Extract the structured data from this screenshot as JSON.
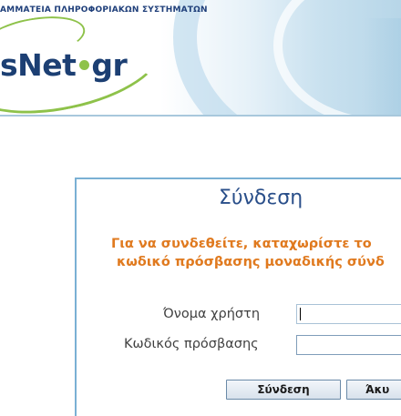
{
  "header": {
    "org_name": "ΑΜΜΑΤΕΙΑ ΠΛΗΡΟΦΟΡΙΑΚΩΝ ΣΥΣΤΗΜΑΤΩΝ",
    "logo_left": "sNet",
    "logo_right": "gr"
  },
  "login": {
    "title": "Σύνδεση",
    "message_line1": "Για να συνδεθείτε, καταχωρίστε το",
    "message_line2": "κωδικό πρόσβασης μοναδικής σύνδ",
    "username_label": "Όνομα χρήστη",
    "username_value": "",
    "password_label": "Κωδικός πρόσβασης",
    "password_value": "",
    "submit_label": "Σύνδεση",
    "cancel_label": "Άκυ"
  },
  "colors": {
    "brand_blue": "#1c3f73",
    "brand_green": "#8ec24a",
    "message_orange": "#e07a1f",
    "panel_border": "#7ab0d4"
  }
}
